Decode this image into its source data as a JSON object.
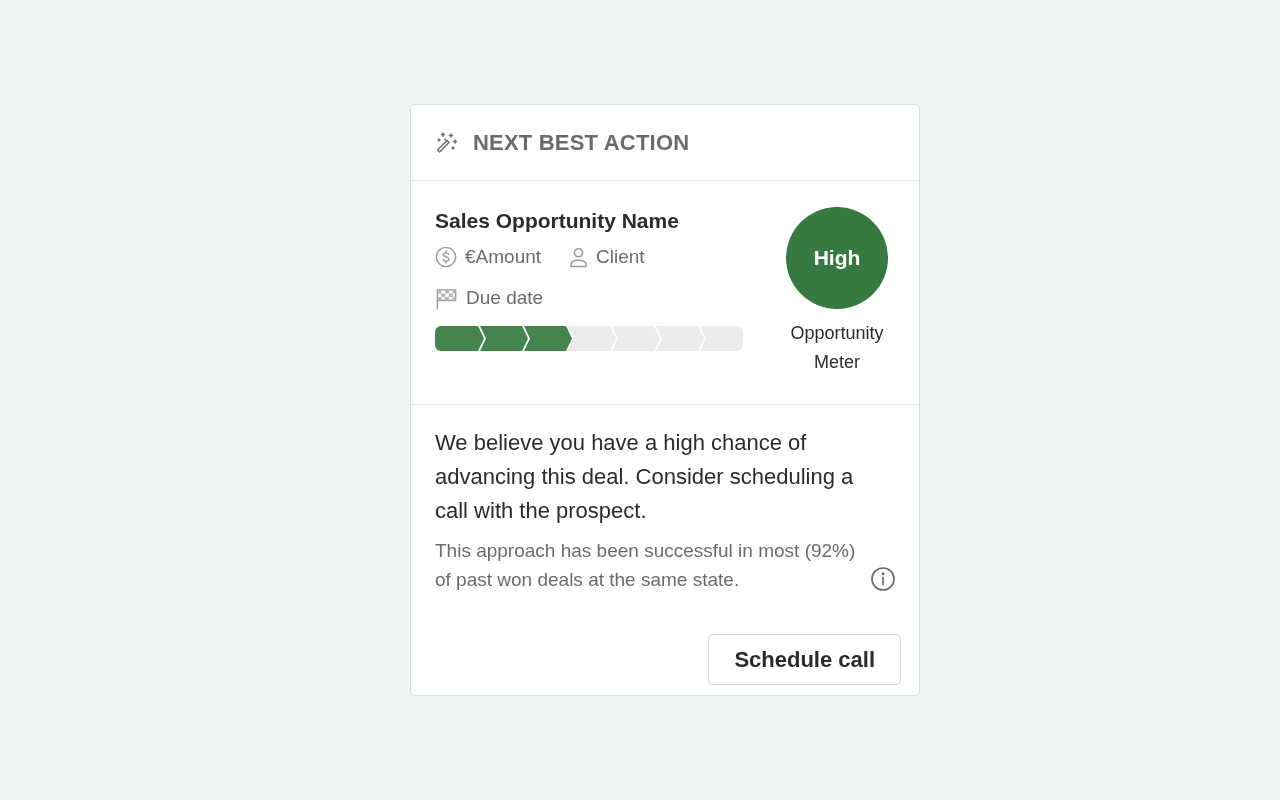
{
  "header": {
    "title": "NEXT BEST ACTION"
  },
  "opportunity": {
    "name": "Sales Opportunity Name",
    "amount": "€Amount",
    "client": "Client",
    "due_date": "Due date",
    "stages": [
      {
        "complete": true
      },
      {
        "complete": true
      },
      {
        "complete": true
      },
      {
        "complete": false
      },
      {
        "complete": false
      },
      {
        "complete": false
      },
      {
        "complete": false
      }
    ]
  },
  "meter": {
    "value": "High",
    "caption": "Opportunity Meter"
  },
  "recommendation": {
    "message": "We believe you have a high chance of advancing this deal. Consider scheduling a call with the prospect.",
    "detail": "This approach has been successful in most (92%) of past won deals at the same state."
  },
  "actions": [
    {
      "label": "Schedule call"
    }
  ]
}
